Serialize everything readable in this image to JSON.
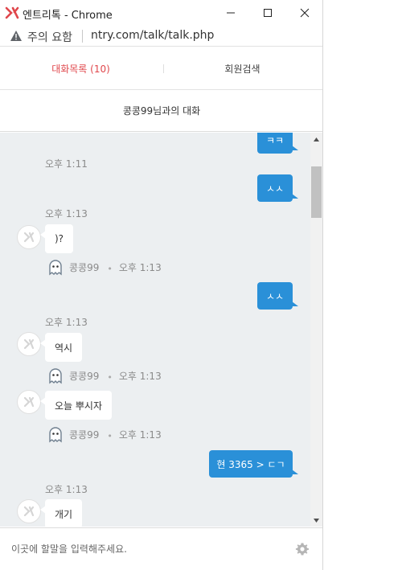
{
  "window": {
    "title": "엔트리톡 - Chrome"
  },
  "addressbar": {
    "warning": "주의 요함",
    "url": "ntry.com/talk/talk.php"
  },
  "tabs": [
    {
      "label": "대화목록 (10)",
      "active": true
    },
    {
      "label": "회원검색",
      "active": false
    }
  ],
  "conversation": {
    "title": "콩콩99님과의 대화"
  },
  "messages": [
    {
      "dir": "out",
      "text": "ㅋㅋ"
    },
    {
      "dir": "out",
      "time": "오후 1:11",
      "text": "ㅅㅅ"
    },
    {
      "dir": "in",
      "time": "오후 1:13",
      "text": ")?",
      "sender": "콩콩99",
      "sender_time": "오후 1:13"
    },
    {
      "dir": "out",
      "text": "ㅅㅅ"
    },
    {
      "dir": "in",
      "time": "오후 1:13",
      "text": "역시",
      "sender": "콩콩99",
      "sender_time": "오후 1:13"
    },
    {
      "dir": "in",
      "text": "오늘 뿌시자",
      "sender": "콩콩99",
      "sender_time": "오후 1:13"
    },
    {
      "dir": "out",
      "text": "현 3365 > ㄷㄱ"
    },
    {
      "dir": "in",
      "time": "오후 1:13",
      "text": "개기"
    }
  ],
  "input": {
    "placeholder": "이곳에 할말을 입력해주세요."
  },
  "colors": {
    "accent_tab": "#e0474c",
    "bubble_out": "#2a90d8",
    "chat_bg": "#eceff1"
  }
}
